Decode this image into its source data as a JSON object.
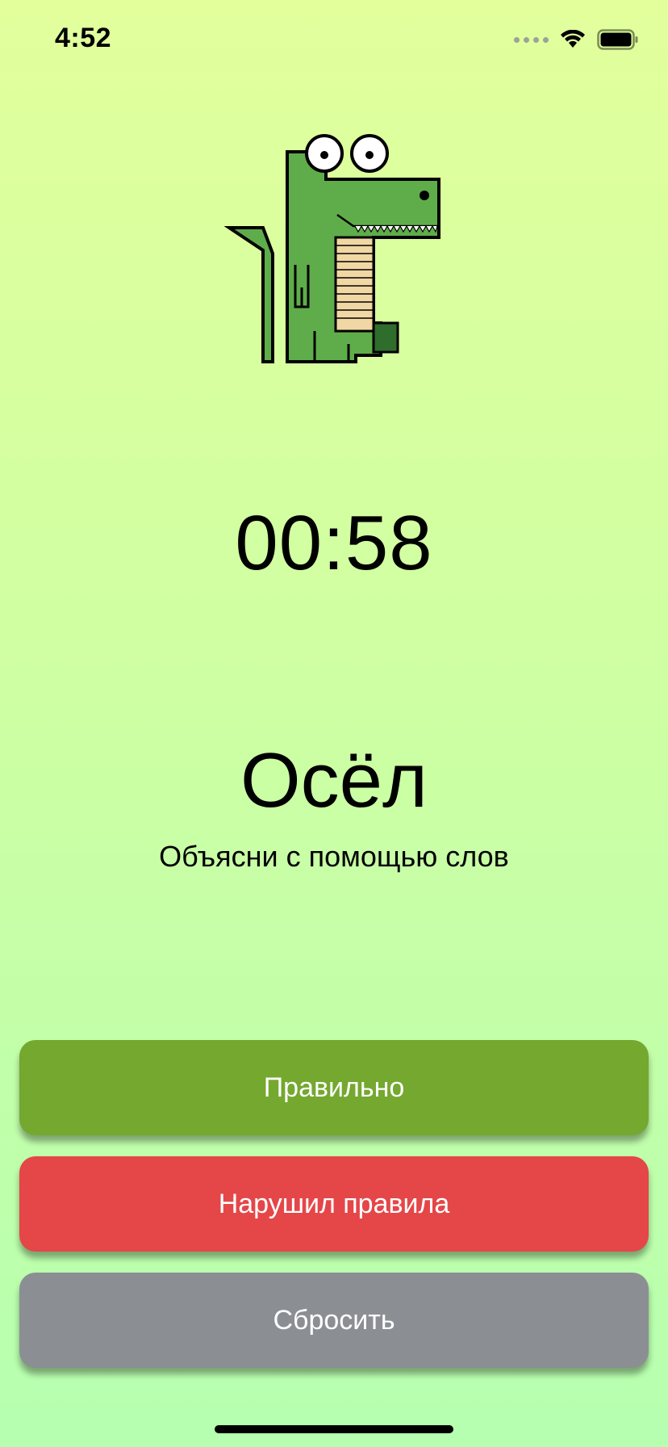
{
  "status_bar": {
    "time": "4:52",
    "icons": [
      "cellular-signal-icon",
      "wifi-icon",
      "battery-icon"
    ]
  },
  "mascot": {
    "icon": "crocodile-mascot-icon",
    "colors": {
      "body": "#5fad4a",
      "belly": "#f0d7a4",
      "foot": "#2f6d2d"
    }
  },
  "timer": {
    "value": "00:58"
  },
  "word": {
    "text": "Осёл",
    "hint": "Объясни с помощью слов"
  },
  "buttons": {
    "correct": {
      "label": "Правильно",
      "color": "#74a82f"
    },
    "violated": {
      "label": "Нарушил правила",
      "color": "#e54648"
    },
    "reset": {
      "label": "Сбросить",
      "color": "#8b8f93"
    }
  },
  "colors": {
    "background_top": "#e2ff9c",
    "background_bottom": "#b6ffb0"
  }
}
